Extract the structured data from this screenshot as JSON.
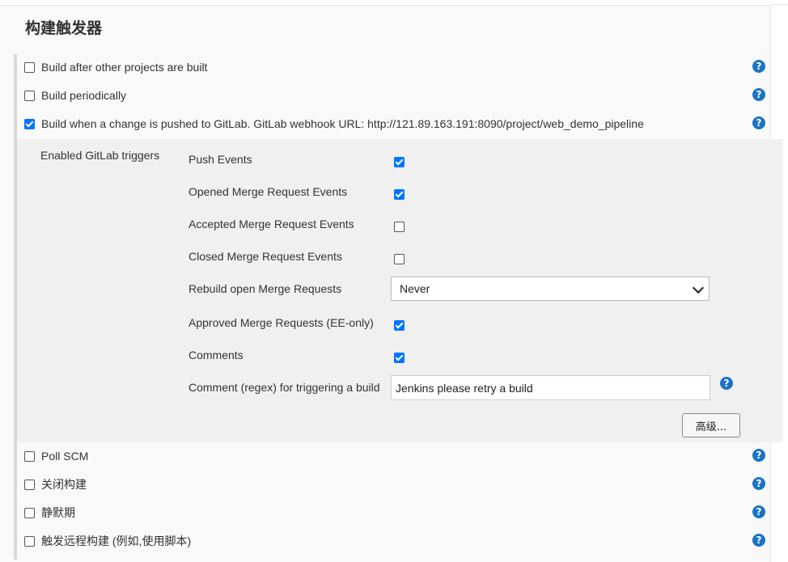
{
  "section": {
    "title": "构建触发器"
  },
  "triggers": [
    {
      "label": "Build after other projects are built",
      "checked": false
    },
    {
      "label": "Build periodically",
      "checked": false
    },
    {
      "label": "Build when a change is pushed to GitLab. GitLab webhook URL: http://121.89.163.191:8090/project/web_demo_pipeline",
      "checked": true
    }
  ],
  "gitlab": {
    "heading": "Enabled GitLab triggers",
    "options": [
      {
        "label": "Push Events",
        "checked": true
      },
      {
        "label": "Opened Merge Request Events",
        "checked": true
      },
      {
        "label": "Accepted Merge Request Events",
        "checked": false
      },
      {
        "label": "Closed Merge Request Events",
        "checked": false
      },
      {
        "label": "Rebuild open Merge Requests",
        "select_value": "Never"
      },
      {
        "label": "Approved Merge Requests (EE-only)",
        "checked": true
      },
      {
        "label": "Comments",
        "checked": true
      },
      {
        "label": "Comment (regex) for triggering a build",
        "input_value": "Jenkins please retry a build"
      }
    ],
    "advanced_button": "高级..."
  },
  "more_triggers": [
    {
      "label": "Poll SCM",
      "checked": false
    },
    {
      "label": "关闭构建",
      "checked": false
    },
    {
      "label": "静默期",
      "checked": false
    },
    {
      "label": "触发远程构建 (例如,使用脚本)",
      "checked": false
    }
  ],
  "help_icon_text": "?",
  "colors": {
    "accent": "#0075ff",
    "help": "#1a73c7"
  }
}
